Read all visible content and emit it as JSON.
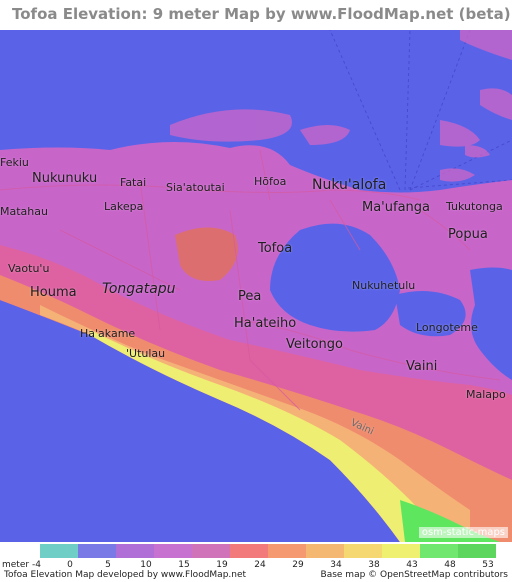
{
  "title": "Tofoa Elevation: 9 meter Map by www.FloodMap.net (beta)",
  "places": [
    {
      "name": "Nukunuku",
      "size": "large",
      "italic": false
    },
    {
      "name": "Fatai",
      "size": "medium",
      "italic": false
    },
    {
      "name": "Sia'atoutai",
      "size": "medium",
      "italic": false
    },
    {
      "name": "Hōfoa",
      "size": "medium",
      "italic": false
    },
    {
      "name": "Nuku'alofa",
      "size": "xl",
      "italic": false
    },
    {
      "name": "Matahau",
      "size": "medium",
      "italic": false
    },
    {
      "name": "Lakepa",
      "size": "medium",
      "italic": false
    },
    {
      "name": "Ma'ufanga",
      "size": "large",
      "italic": false
    },
    {
      "name": "Tukutonga",
      "size": "medium",
      "italic": false
    },
    {
      "name": "Popua",
      "size": "large",
      "italic": false
    },
    {
      "name": "Tofoa",
      "size": "large",
      "italic": false
    },
    {
      "name": "Vaotu'u",
      "size": "medium",
      "italic": false
    },
    {
      "name": "Tongatapu",
      "size": "italic",
      "italic": true
    },
    {
      "name": "Houma",
      "size": "large",
      "italic": false
    },
    {
      "name": "Pea",
      "size": "large",
      "italic": false
    },
    {
      "name": "Nukuhetulu",
      "size": "medium",
      "italic": false
    },
    {
      "name": "Ha'ateiho",
      "size": "large",
      "italic": false
    },
    {
      "name": "Longoteme",
      "size": "medium",
      "italic": false
    },
    {
      "name": "Ha'akame",
      "size": "medium",
      "italic": false
    },
    {
      "name": "Veitongo",
      "size": "large",
      "italic": false
    },
    {
      "name": "'Utulau",
      "size": "medium",
      "italic": false
    },
    {
      "name": "Vaini",
      "size": "large",
      "italic": false
    },
    {
      "name": "Malapo",
      "size": "medium",
      "italic": false
    },
    {
      "name": "Vaini",
      "size": "small",
      "italic": false
    },
    {
      "name": "Fekiu",
      "size": "medium",
      "italic": false
    }
  ],
  "attribution_overlay": "osm-static-maps",
  "legend": {
    "unit": "meter",
    "first_label": "-4",
    "labels": [
      "0",
      "5",
      "10",
      "15",
      "19",
      "24",
      "29",
      "34",
      "38",
      "43",
      "48",
      "53"
    ],
    "colors": [
      "#6fcfc6",
      "#7a7ae6",
      "#b06fd6",
      "#c772d0",
      "#d073b8",
      "#f27a7a",
      "#f59a70",
      "#f5b872",
      "#f5d872",
      "#f0f070",
      "#70e870",
      "#5cd65c"
    ]
  },
  "footer": {
    "left": "Tofoa Elevation Map developed by www.FloodMap.net",
    "right": "Base map © OpenStreetMap contributors"
  },
  "map_colors": {
    "water": "#5a63e8",
    "land_low": "#c865c9",
    "land_mid": "#e2629a",
    "land_high": "#f08c6e",
    "coast_peach": "#f5b277",
    "coast_yellow": "#eeee72",
    "coast_green": "#5ee65e"
  }
}
